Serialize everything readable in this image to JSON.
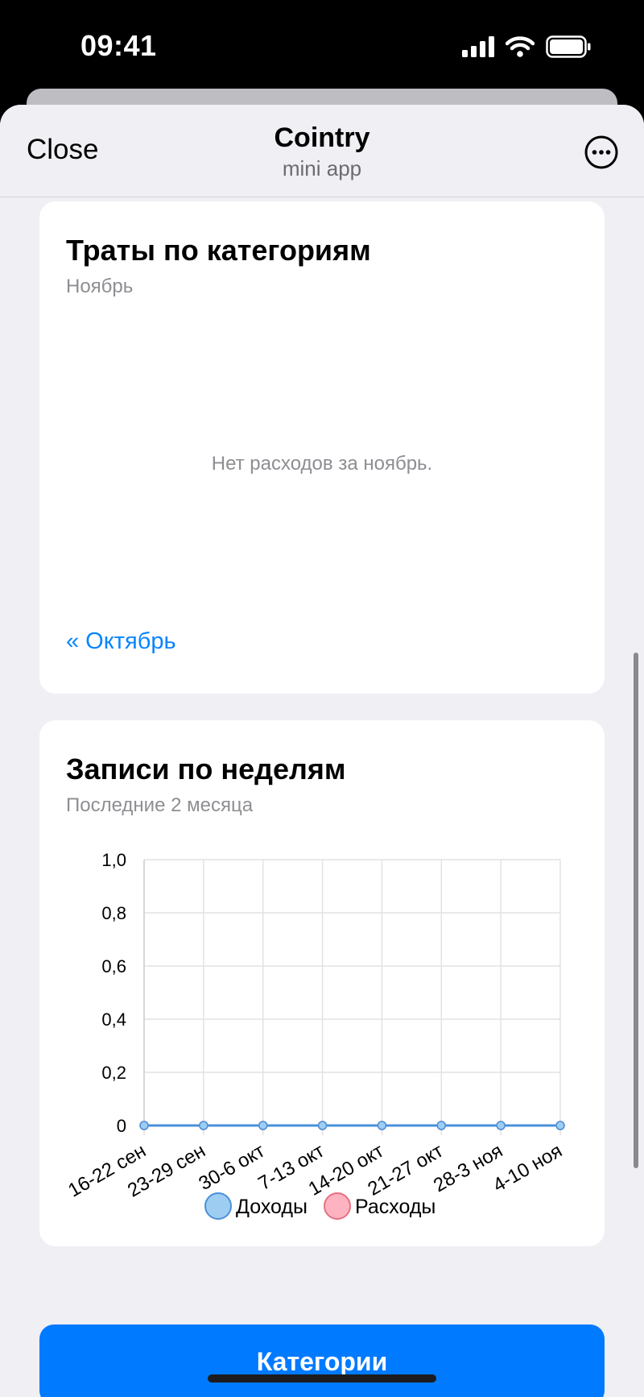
{
  "status_bar": {
    "time": "09:41"
  },
  "nav": {
    "close_label": "Close",
    "title": "Cointry",
    "subtitle": "mini app"
  },
  "categories_card": {
    "title": "Траты по категориям",
    "subtitle": "Ноябрь",
    "empty_message": "Нет расходов за ноябрь.",
    "prev_link": "« Октябрь"
  },
  "weekly_card": {
    "title": "Записи по неделям",
    "subtitle": "Последние 2 месяца"
  },
  "chart_data": {
    "type": "line",
    "categories": [
      "16-22 сен",
      "23-29 сен",
      "30-6 окт",
      "7-13 окт",
      "14-20 окт",
      "21-27 окт",
      "28-3 ноя",
      "4-10 ноя"
    ],
    "series": [
      {
        "name": "Доходы",
        "values": [
          0,
          0,
          0,
          0,
          0,
          0,
          0,
          0
        ],
        "color": "#4a90d9",
        "fill": "#9ecdf2"
      },
      {
        "name": "Расходы",
        "values": [
          0,
          0,
          0,
          0,
          0,
          0,
          0,
          0
        ],
        "color": "#e8707f",
        "fill": "#ffb3c1"
      }
    ],
    "yticks": [
      "1,0",
      "0,8",
      "0,6",
      "0,4",
      "0,2",
      "0"
    ],
    "ylim": [
      0,
      1
    ],
    "grid": true,
    "legend": "bottom"
  },
  "footer": {
    "button_label": "Категории"
  },
  "colors": {
    "accent": "#007aff",
    "link": "#0a84ff",
    "background": "#efeff4"
  }
}
